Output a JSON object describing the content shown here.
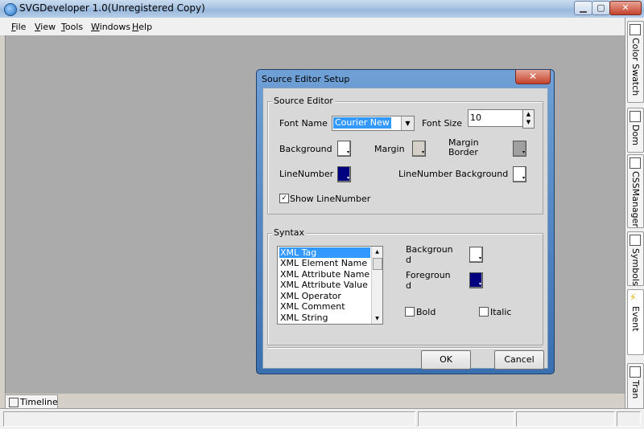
{
  "window": {
    "title": "SVGDeveloper 1.0(Unregistered Copy)"
  },
  "menu": [
    {
      "label": "File",
      "u": "F",
      "rest": "ile"
    },
    {
      "label": "View",
      "u": "V",
      "rest": "iew"
    },
    {
      "label": "Tools",
      "u": "T",
      "rest": "ools"
    },
    {
      "label": "Windows",
      "u": "W",
      "rest": "indows"
    },
    {
      "label": "Help",
      "u": "H",
      "rest": "elp"
    }
  ],
  "dock_tabs": [
    "Color Swatch",
    "Dom",
    "CSSManager",
    "Symbols",
    "Event",
    "Tran"
  ],
  "bottom_tab": "Timeline",
  "dialog": {
    "title": "Source Editor Setup",
    "source_editor": {
      "group_label": "Source Editor",
      "font_name_label": "Font Name",
      "font_name_value": "Courier New",
      "font_size_label": "Font Size",
      "font_size_value": "10",
      "background_label": "Background",
      "margin_label": "Margin",
      "margin_border_label": "Margin Border",
      "line_number_label": "LineNumber",
      "line_number_bg_label": "LineNumber Background",
      "show_line_number_label": "Show LineNumber",
      "show_line_number_checked": "✓"
    },
    "syntax": {
      "group_label": "Syntax",
      "items": [
        "XML Tag",
        "XML Element Name",
        "XML Attribute Name",
        "XML Attribute Value",
        "XML Operator",
        "XML Comment",
        "XML String"
      ],
      "background_label": "Background",
      "foreground_label": "Foreground",
      "bold_label": "Bold",
      "italic_label": "Italic"
    },
    "ok_label": "OK",
    "cancel_label": "Cancel"
  },
  "colors": {
    "background_swatch": "#ffffff",
    "margin_swatch": "#d4d0c8",
    "margin_border_swatch": "#a0a0a0",
    "line_number_swatch": "#000080",
    "line_number_bg_swatch": "#ffffff",
    "syntax_bg_swatch": "#ffffff",
    "syntax_fg_swatch": "#000080"
  }
}
